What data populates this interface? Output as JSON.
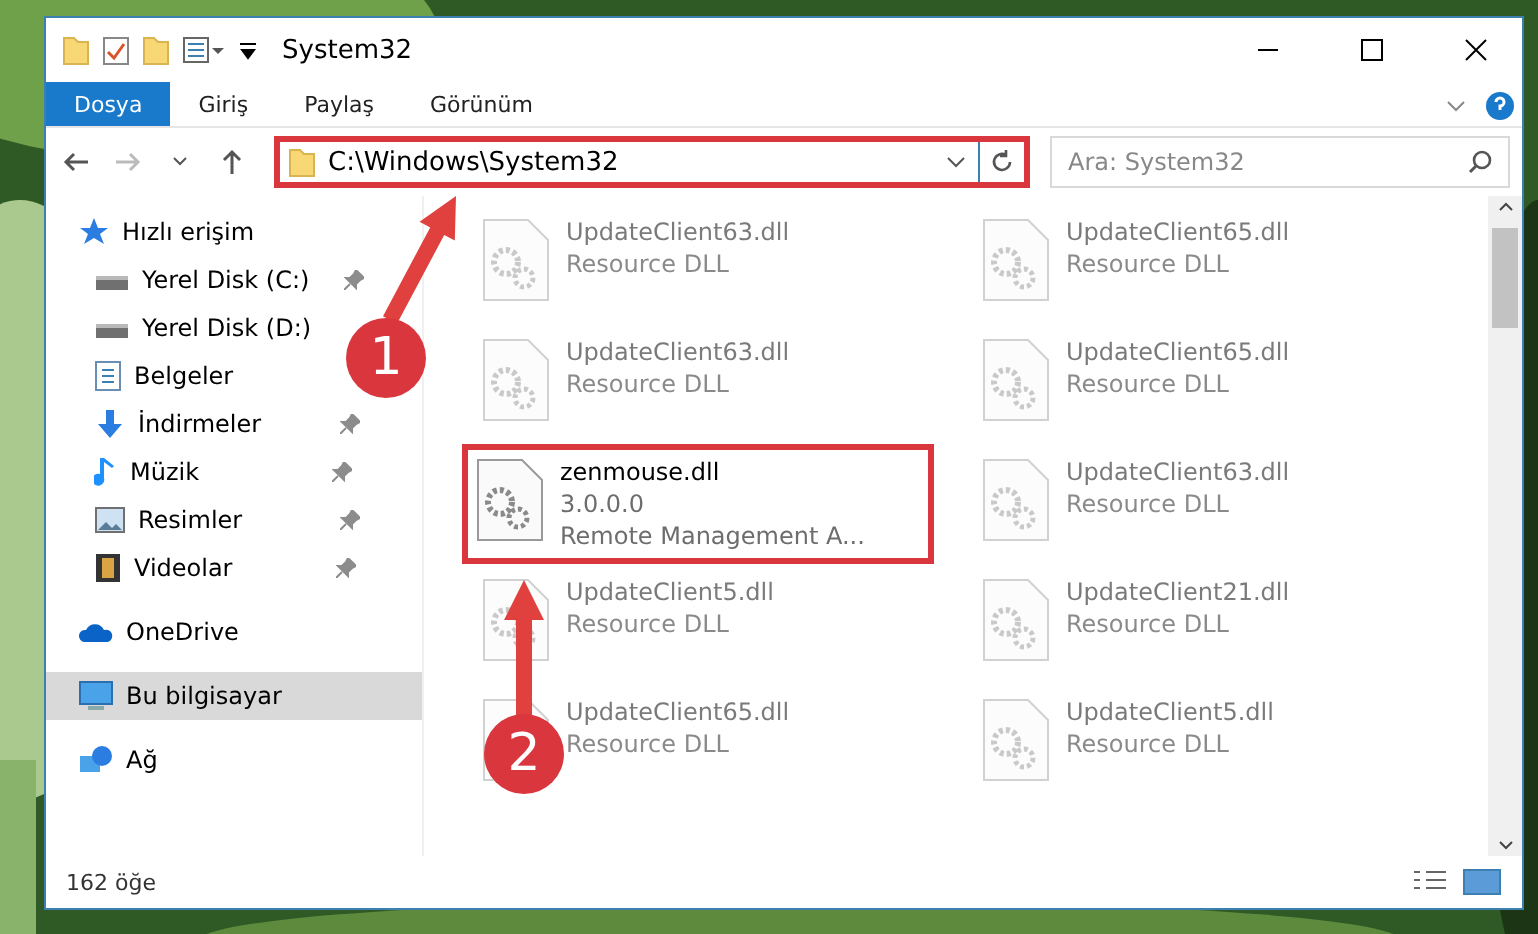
{
  "window": {
    "title": "System32"
  },
  "ribbon": {
    "tabs": [
      {
        "label": "Dosya",
        "selected": true
      },
      {
        "label": "Giriş",
        "selected": false
      },
      {
        "label": "Paylaş",
        "selected": false
      },
      {
        "label": "Görünüm",
        "selected": false
      }
    ]
  },
  "address": {
    "path": "C:\\Windows\\System32",
    "highlighted": true
  },
  "search": {
    "placeholder": "Ara: System32"
  },
  "sidebar": {
    "items": [
      {
        "label": "Hızlı erişim",
        "kind": "star",
        "selected": false,
        "pinned": false,
        "children": [
          {
            "label": "Yerel Disk (C:)",
            "kind": "drive",
            "selected": false,
            "pinned": true
          },
          {
            "label": "Yerel Disk (D:)",
            "kind": "drive",
            "selected": false,
            "pinned": false
          },
          {
            "label": "Belgeler",
            "kind": "document",
            "selected": false,
            "pinned": false
          },
          {
            "label": "İndirmeler",
            "kind": "download",
            "selected": false,
            "pinned": true
          },
          {
            "label": "Müzik",
            "kind": "music",
            "selected": false,
            "pinned": true
          },
          {
            "label": "Resimler",
            "selected": false,
            "pinned": true
          },
          {
            "label": "Videolar",
            "kind": "video",
            "selected": false,
            "pinned": true
          }
        ]
      },
      {
        "label": "OneDrive",
        "kind": "cloud",
        "selected": false,
        "pinned": false
      },
      {
        "label": "Bu bilgisayar",
        "kind": "computer",
        "selected": true,
        "pinned": false
      },
      {
        "label": "Ağ",
        "kind": "network",
        "selected": false,
        "pinned": false
      }
    ]
  },
  "files": [
    {
      "name": "UpdateClient63.dll",
      "description": "Resource DLL",
      "blurred": true,
      "highlighted": false
    },
    {
      "name": "UpdateClient65.dll",
      "description": "Resource DLL",
      "blurred": true,
      "highlighted": false
    },
    {
      "name": "UpdateClient63.dll",
      "description": "Resource DLL",
      "blurred": true,
      "highlighted": false
    },
    {
      "name": "UpdateClient65.dll",
      "description": "Resource DLL",
      "blurred": true,
      "highlighted": false
    },
    {
      "name": "zenmouse.dll",
      "version": "3.0.0.0",
      "description": "Remote Management A...",
      "blurred": false,
      "highlighted": true
    },
    {
      "name": "UpdateClient63.dll",
      "description": "Resource DLL",
      "blurred": true,
      "highlighted": false
    },
    {
      "name": "UpdateClient5.dll",
      "description": "Resource DLL",
      "blurred": true,
      "highlighted": false
    },
    {
      "name": "UpdateClient21.dll",
      "description": "Resource DLL",
      "blurred": true,
      "highlighted": false
    },
    {
      "name": "UpdateClient65.dll",
      "description": "Resource DLL",
      "blurred": true,
      "highlighted": false
    },
    {
      "name": "UpdateClient5.dll",
      "description": "Resource DLL",
      "blurred": true,
      "highlighted": false
    }
  ],
  "status_bar": {
    "count": "162 öğe"
  },
  "annotations": [
    {
      "label": "1"
    },
    {
      "label": "2"
    }
  ]
}
